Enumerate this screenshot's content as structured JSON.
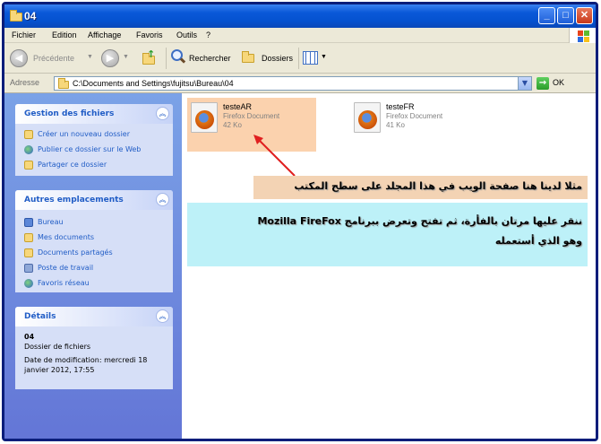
{
  "window": {
    "title": "04"
  },
  "menu": [
    "Fichier",
    "Edition",
    "Affichage",
    "Favoris",
    "Outils",
    "?"
  ],
  "toolbar": {
    "back_label": "Précédente",
    "search_label": "Rechercher",
    "folders_label": "Dossiers"
  },
  "address": {
    "label": "Adresse",
    "value": "C:\\Documents and Settings\\fujitsu\\Bureau\\04",
    "go_label": "OK"
  },
  "sidebar": {
    "tasks": {
      "title": "Gestion des fichiers",
      "items": [
        "Créer un nouveau dossier",
        "Publier ce dossier sur le Web",
        "Partager ce dossier"
      ]
    },
    "places": {
      "title": "Autres emplacements",
      "items": [
        "Bureau",
        "Mes documents",
        "Documents partagés",
        "Poste de travail",
        "Favoris réseau"
      ]
    },
    "details": {
      "title": "Détails",
      "name": "04",
      "type": "Dossier de fichiers",
      "modified_line1": "Date de modification: mercredi 18",
      "modified_line2": "janvier 2012, 17:55"
    }
  },
  "files": [
    {
      "name": "testeAR",
      "type": "Firefox Document",
      "size": "42 Ko"
    },
    {
      "name": "testeFR",
      "type": "Firefox Document",
      "size": "41 Ko"
    }
  ],
  "annotations": {
    "note1": "مثلا لدينا هنا صفحة الويب في هذا المجلد على سطح المكتب",
    "note2_line1": "ننقر عليها مرتان بالفأرة، ثم تفتح وتعرض ببرنامج Mozilla FireFox",
    "note2_line2": "وهو الذي أستعمله"
  },
  "colors": {
    "titlebar": "#0552d0",
    "sidebar": "#6375d6",
    "panel_title": "#215dc6",
    "arrow": "#e02020",
    "note1_bg": "#f3d3b4",
    "note2_bg": "#bdf1f8",
    "highlight_bg": "#fbd2ae"
  },
  "icons": {
    "folder": "folder-icon",
    "firefox": "firefox-document-icon",
    "windows_logo": "windows-logo-icon"
  }
}
